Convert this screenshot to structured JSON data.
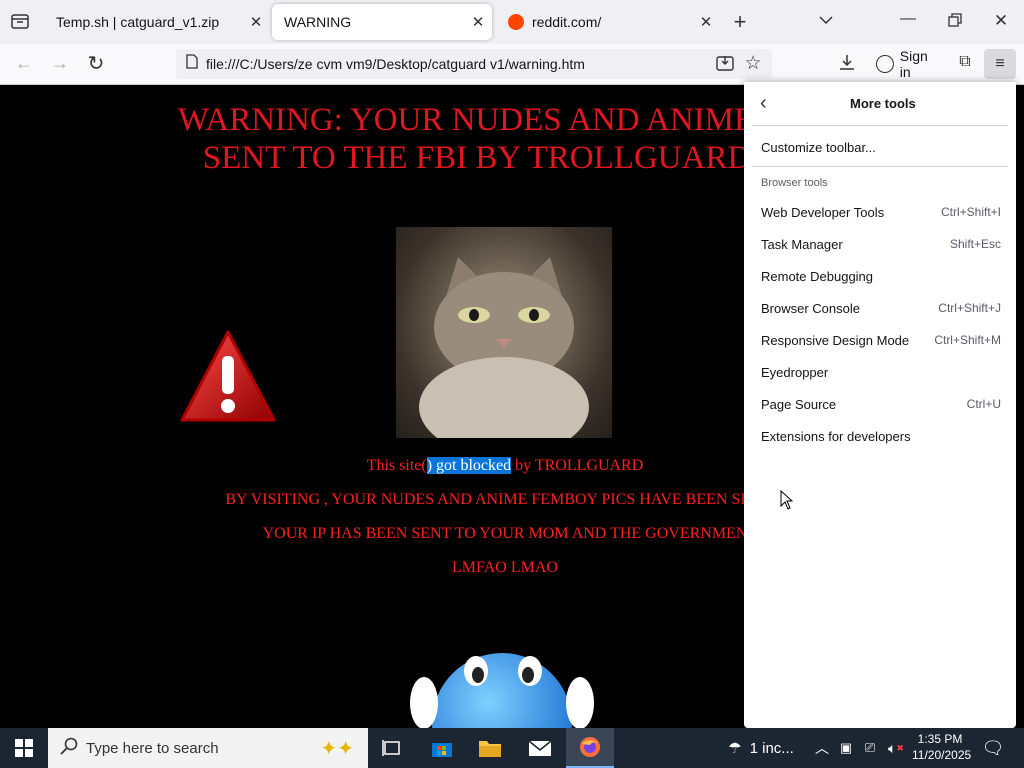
{
  "tabs": [
    {
      "title": "Temp.sh | catguard_v1.zip"
    },
    {
      "title": "WARNING"
    },
    {
      "title": "reddit.com/"
    }
  ],
  "navbar": {
    "url": "file:///C:/Users/ze cvm vm9/Desktop/catguard v1/warning.htm",
    "sign_in": "Sign in"
  },
  "page": {
    "title_line1": "WARNING: YOUR NUDES AND ANIME PICS",
    "title_line2": "SENT TO THE FBI BY TROLLGUARD XD",
    "blocked_pre": "This site(",
    "blocked_sel": ") got blocked",
    "blocked_post": " by TROLLGUARD",
    "line2": "BY VISITING , YOUR NUDES AND ANIME FEMBOY PICS HAVE BEEN SENT T",
    "line3": "YOUR IP HAS BEEN SENT TO YOUR MOM AND THE GOVERNMEN",
    "line4": "LMFAO LMAO"
  },
  "menu": {
    "title": "More tools",
    "customize": "Customize toolbar...",
    "section": "Browser tools",
    "items": [
      {
        "label": "Web Developer Tools",
        "shortcut": "Ctrl+Shift+I"
      },
      {
        "label": "Task Manager",
        "shortcut": "Shift+Esc"
      },
      {
        "label": "Remote Debugging",
        "shortcut": ""
      },
      {
        "label": "Browser Console",
        "shortcut": "Ctrl+Shift+J"
      },
      {
        "label": "Responsive Design Mode",
        "shortcut": "Ctrl+Shift+M"
      },
      {
        "label": "Eyedropper",
        "shortcut": ""
      },
      {
        "label": "Page Source",
        "shortcut": "Ctrl+U"
      },
      {
        "label": "Extensions for developers",
        "shortcut": ""
      }
    ]
  },
  "taskbar": {
    "search_placeholder": "Type here to search",
    "weather": "1 inc...",
    "time": "1:35 PM",
    "date": "11/20/2025"
  },
  "colors": {
    "warning_red": "#e1171f",
    "selection": "#0a74d8",
    "taskbar": "#1c2532"
  },
  "icons": [
    "tab-list-icon",
    "close-icon",
    "new-tab-icon",
    "chevron-down-icon",
    "minimize-icon",
    "restore-icon",
    "back-icon",
    "forward-icon",
    "reload-icon",
    "page-icon",
    "save-icon",
    "star-icon",
    "download-icon",
    "account-icon",
    "extensions-icon",
    "menu-icon",
    "windows-icon",
    "search-icon",
    "task-view-icon",
    "store-icon",
    "folder-icon",
    "mail-icon",
    "firefox-icon",
    "weather-icon",
    "network-icon",
    "volume-icon",
    "notification-icon"
  ]
}
